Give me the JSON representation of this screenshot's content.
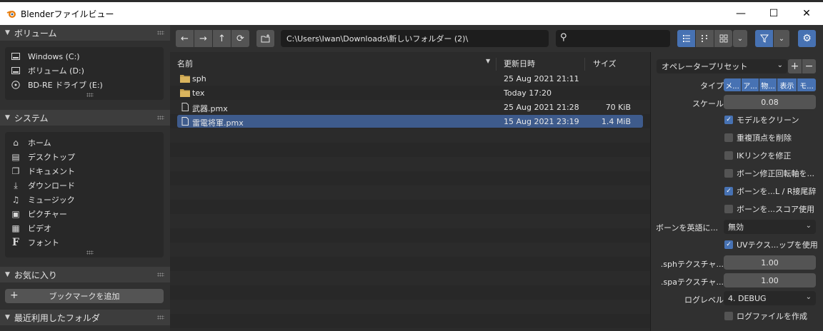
{
  "window": {
    "title": "Blenderファイルビュー",
    "minimize": "—",
    "maximize": "☐",
    "close": "✕"
  },
  "sidebar": {
    "volumes": {
      "title": "ボリューム",
      "items": [
        {
          "label": "Windows (C:)",
          "icon": "drive-icon"
        },
        {
          "label": "ボリューム (D:)",
          "icon": "drive-icon"
        },
        {
          "label": "BD-RE ドライブ (E:)",
          "icon": "disc-icon"
        }
      ]
    },
    "system": {
      "title": "システム",
      "items": [
        {
          "label": "ホーム",
          "icon": "home-icon"
        },
        {
          "label": "デスクトップ",
          "icon": "desktop-icon"
        },
        {
          "label": "ドキュメント",
          "icon": "documents-icon"
        },
        {
          "label": "ダウンロード",
          "icon": "download-icon"
        },
        {
          "label": "ミュージック",
          "icon": "music-icon"
        },
        {
          "label": "ピクチャー",
          "icon": "picture-icon"
        },
        {
          "label": "ビデオ",
          "icon": "video-icon"
        },
        {
          "label": "フォント",
          "icon": "font-icon"
        }
      ]
    },
    "favorites": {
      "title": "お気に入り",
      "add_bookmark": "ブックマークを追加"
    },
    "recent": {
      "title": "最近利用したフォルダ"
    }
  },
  "toolbar": {
    "path": "C:\\Users\\Iwan\\Downloads\\新しいフォルダー (2)\\",
    "search_placeholder": ""
  },
  "columns": {
    "name": "名前",
    "date": "更新日時",
    "size": "サイズ"
  },
  "files": [
    {
      "name": "sph",
      "date": "25 Aug 2021 21:11",
      "size": "",
      "type": "folder",
      "selected": false
    },
    {
      "name": "tex",
      "date": "Today 17:20",
      "size": "",
      "type": "folder",
      "selected": false
    },
    {
      "name": "武器.pmx",
      "date": "25 Aug 2021 21:28",
      "size": "70 KiB",
      "type": "file",
      "selected": false
    },
    {
      "name": "雷電将軍.pmx",
      "date": "15 Aug 2021 23:19",
      "size": "1.4 MiB",
      "type": "file",
      "selected": true
    }
  ],
  "props": {
    "preset": "オペレータープリセット",
    "type_label": "タイプ",
    "type_buttons": [
      "メ...",
      "ア...",
      "物...",
      "表示",
      "モ..."
    ],
    "scale_label": "スケール",
    "scale_value": "0.08",
    "cb_clean_model": "モデルをクリーン",
    "cb_remove_doubles": "重複頂点を削除",
    "cb_fix_ik": "IKリンクを修正",
    "cb_bone_fix_axis": "ボーン修正回転軸を...",
    "cb_bone_lr": "ボーンを...L / R接尾辞",
    "cb_bone_scope": "ボーンを...スコア使用",
    "bone_english_label": "ボーンを英語に...",
    "bone_english_value": "無効",
    "cb_uv_texture": "UVテクス...ップを使用",
    "sph_label": ".sphテクスチャ...",
    "sph_value": "1.00",
    "spa_label": ".spaテクスチャ...",
    "spa_value": "1.00",
    "log_level_label": "ログレベル",
    "log_level_value": "4. DEBUG",
    "cb_create_log": "ログファイルを作成"
  }
}
